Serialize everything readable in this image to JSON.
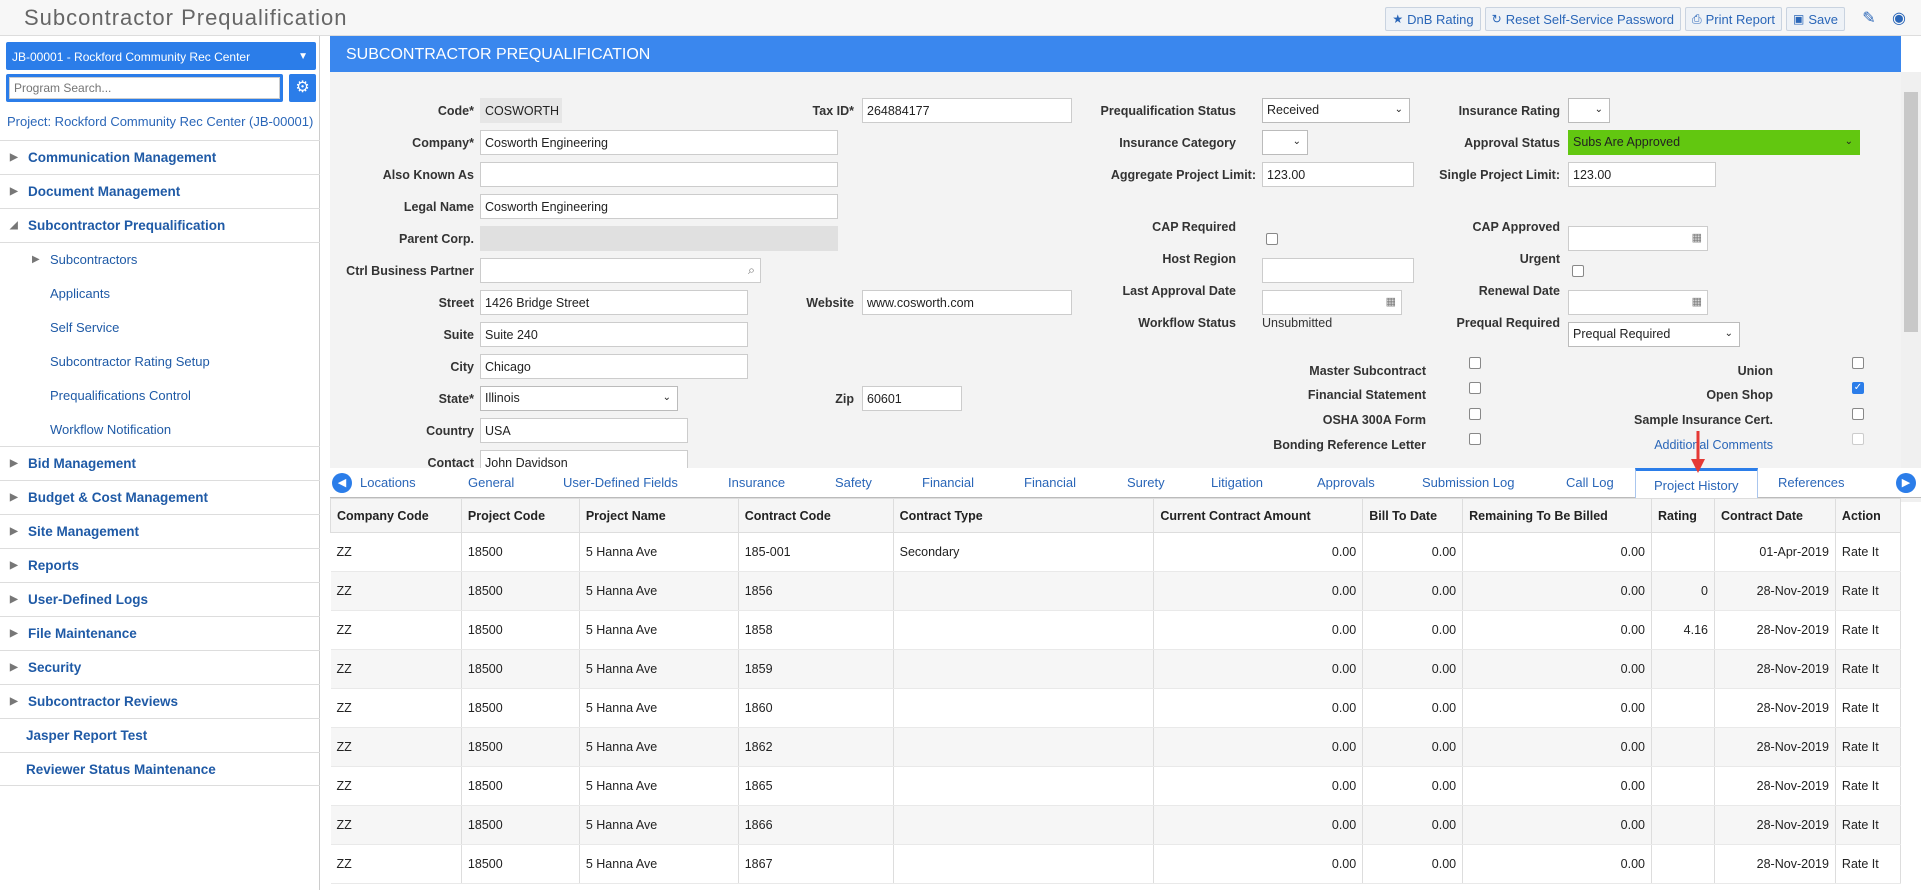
{
  "app": {
    "title": "Subcontractor Prequalification"
  },
  "toolbar": {
    "dnb": "DnB Rating",
    "reset": "Reset Self-Service Password",
    "print": "Print Report",
    "save": "Save",
    "icons": [
      "star-icon",
      "refresh-icon",
      "print-icon",
      "save-icon",
      "edit-icon",
      "user-icon"
    ]
  },
  "sidebar": {
    "project_select": "JB-00001 - Rockford Community Rec Center",
    "search_placeholder": "Program Search...",
    "project_label": "Project: Rockford Community Rec Center (JB-00001)",
    "items": [
      {
        "label": "Communication Management"
      },
      {
        "label": "Document Management"
      },
      {
        "label": "Subcontractor Prequalification"
      },
      {
        "label": "Subcontractors"
      },
      {
        "label": "Applicants"
      },
      {
        "label": "Self Service"
      },
      {
        "label": "Subcontractor Rating Setup"
      },
      {
        "label": "Prequalifications Control"
      },
      {
        "label": "Workflow Notification"
      },
      {
        "label": "Bid Management"
      },
      {
        "label": "Budget & Cost Management"
      },
      {
        "label": "Site Management"
      },
      {
        "label": "Reports"
      },
      {
        "label": "User-Defined Logs"
      },
      {
        "label": "File Maintenance"
      },
      {
        "label": "Security"
      },
      {
        "label": "Subcontractor Reviews"
      },
      {
        "label": "Jasper Report Test"
      },
      {
        "label": "Reviewer Status Maintenance"
      }
    ]
  },
  "header": {
    "title": "SUBCONTRACTOR PREQUALIFICATION"
  },
  "form": {
    "code_label": "Code*",
    "code": "COSWORTH",
    "tax_label": "Tax ID*",
    "tax": "264884177",
    "company_label": "Company*",
    "company": "Cosworth Engineering",
    "aka_label": "Also Known As",
    "aka": "",
    "legal_label": "Legal Name",
    "legal": "Cosworth Engineering",
    "parent_label": "Parent Corp.",
    "parent": "",
    "ctrl_label": "Ctrl Business Partner",
    "ctrl": "",
    "street_label": "Street",
    "street": "1426 Bridge Street",
    "website_label": "Website",
    "website": "www.cosworth.com",
    "suite_label": "Suite",
    "suite": "Suite 240",
    "city_label": "City",
    "city": "Chicago",
    "state_label": "State*",
    "state": "Illinois",
    "zip_label": "Zip",
    "zip": "60601",
    "country_label": "Country",
    "country": "USA",
    "contact_label": "Contact",
    "contact": "John Davidson",
    "prequal_status_label": "Prequalification Status",
    "prequal_status": "Received",
    "ins_rating_label": "Insurance Rating",
    "ins_rating": "",
    "ins_cat_label": "Insurance Category",
    "ins_cat": "",
    "approval_label": "Approval Status",
    "approval": "Subs Are Approved",
    "agg_label": "Aggregate Project Limit:",
    "agg": "123.00",
    "single_label": "Single Project Limit:",
    "single": "123.00",
    "cap_req_label": "CAP Required",
    "cap_appr_label": "CAP Approved",
    "cap_appr": "",
    "host_label": "Host Region",
    "host": "",
    "urgent_label": "Urgent",
    "last_appr_label": "Last Approval Date",
    "last_appr": "",
    "renewal_label": "Renewal Date",
    "renewal": "",
    "wf_label": "Workflow Status",
    "wf": "Unsubmitted",
    "prequal_req_label": "Prequal Required",
    "prequal_req": "Prequal Required",
    "master_label": "Master Subcontract",
    "union_label": "Union",
    "fin_label": "Financial Statement",
    "open_shop_label": "Open Shop",
    "osha_label": "OSHA 300A Form",
    "sample_label": "Sample Insurance Cert.",
    "bonding_label": "Bonding Reference Letter",
    "additional_label": "Additional Comments"
  },
  "tabs": [
    "Locations",
    "General",
    "User-Defined Fields",
    "Insurance",
    "Safety",
    "Financial",
    "Financial",
    "Surety",
    "Litigation",
    "Approvals",
    "Submission Log",
    "Call Log",
    "Project History",
    "References"
  ],
  "active_tab": "Project History",
  "grid": {
    "columns": [
      "Company Code",
      "Project Code",
      "Project Name",
      "Contract Code",
      "Contract Type",
      "Current Contract Amount",
      "Bill To Date",
      "Remaining To Be Billed",
      "Rating",
      "Contract Date",
      "Action"
    ],
    "rows": [
      [
        "ZZ",
        "18500",
        "5 Hanna Ave",
        "185-001",
        "Secondary",
        "0.00",
        "0.00",
        "0.00",
        "",
        "01-Apr-2019",
        "Rate It"
      ],
      [
        "ZZ",
        "18500",
        "5 Hanna Ave",
        "1856",
        "",
        "0.00",
        "0.00",
        "0.00",
        "0",
        "28-Nov-2019",
        "Rate It"
      ],
      [
        "ZZ",
        "18500",
        "5 Hanna Ave",
        "1858",
        "",
        "0.00",
        "0.00",
        "0.00",
        "4.16",
        "28-Nov-2019",
        "Rate It"
      ],
      [
        "ZZ",
        "18500",
        "5 Hanna Ave",
        "1859",
        "",
        "0.00",
        "0.00",
        "0.00",
        "",
        "28-Nov-2019",
        "Rate It"
      ],
      [
        "ZZ",
        "18500",
        "5 Hanna Ave",
        "1860",
        "",
        "0.00",
        "0.00",
        "0.00",
        "",
        "28-Nov-2019",
        "Rate It"
      ],
      [
        "ZZ",
        "18500",
        "5 Hanna Ave",
        "1862",
        "",
        "0.00",
        "0.00",
        "0.00",
        "",
        "28-Nov-2019",
        "Rate It"
      ],
      [
        "ZZ",
        "18500",
        "5 Hanna Ave",
        "1865",
        "",
        "0.00",
        "0.00",
        "0.00",
        "",
        "28-Nov-2019",
        "Rate It"
      ],
      [
        "ZZ",
        "18500",
        "5 Hanna Ave",
        "1866",
        "",
        "0.00",
        "0.00",
        "0.00",
        "",
        "28-Nov-2019",
        "Rate It"
      ],
      [
        "ZZ",
        "18500",
        "5 Hanna Ave",
        "1867",
        "",
        "0.00",
        "0.00",
        "0.00",
        "",
        "28-Nov-2019",
        "Rate It"
      ]
    ]
  },
  "colors": {
    "accent": "#2b7de9",
    "header": "#3a87ee",
    "approved": "#62c710",
    "link": "#2a66b8",
    "arrow": "#e53935"
  }
}
